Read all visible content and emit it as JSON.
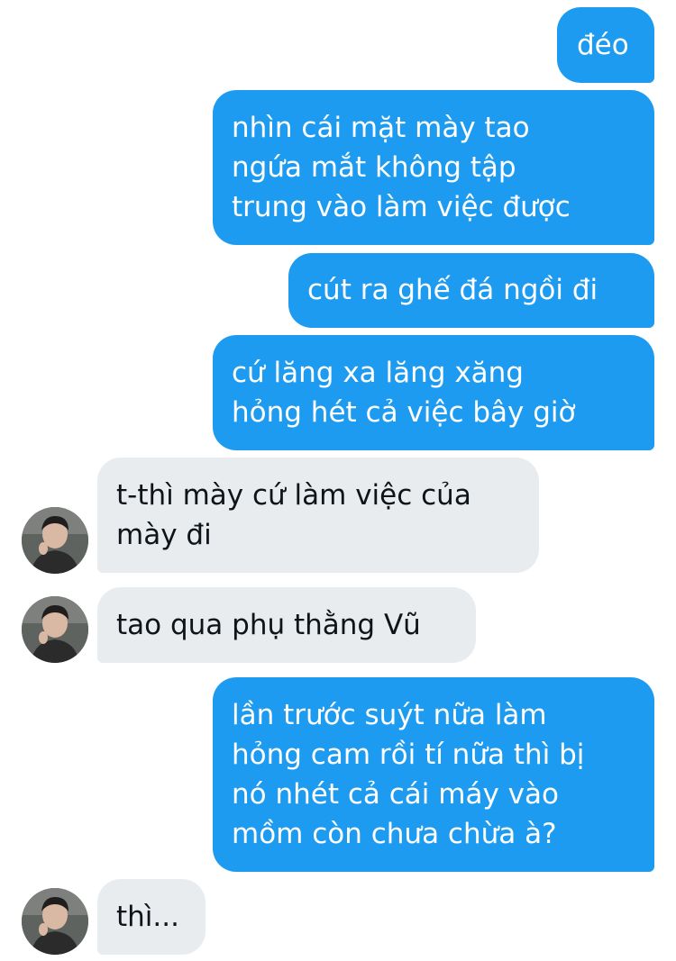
{
  "conversation": {
    "messages": [
      {
        "side": "sent",
        "text": "đéo"
      },
      {
        "side": "sent",
        "text": "nhìn cái mặt mày tao\nngứa mắt không tập\ntrung vào làm việc được"
      },
      {
        "side": "sent",
        "text": "cút ra ghế đá ngồi đi"
      },
      {
        "side": "sent",
        "text": "cứ lăng xa lăng xăng\nhỏng hét cả việc bây giờ"
      },
      {
        "side": "received",
        "text": "t-thì mày cứ làm việc của\nmày đi"
      },
      {
        "side": "received",
        "text": "tao qua phụ thằng Vũ"
      },
      {
        "side": "sent",
        "text": "lần trước suýt nữa làm\nhỏng cam rồi tí nữa thì bị\nnó nhét cả cái máy vào\nmồm còn chưa chừa à?"
      },
      {
        "side": "received",
        "text": "thì..."
      }
    ]
  },
  "colors": {
    "sent_bubble": "#1d9bf0",
    "received_bubble": "#e9ecef",
    "sent_text": "#ffffff",
    "received_text": "#0f1419"
  },
  "icons": {
    "contact_avatar": "user-avatar-photo"
  }
}
